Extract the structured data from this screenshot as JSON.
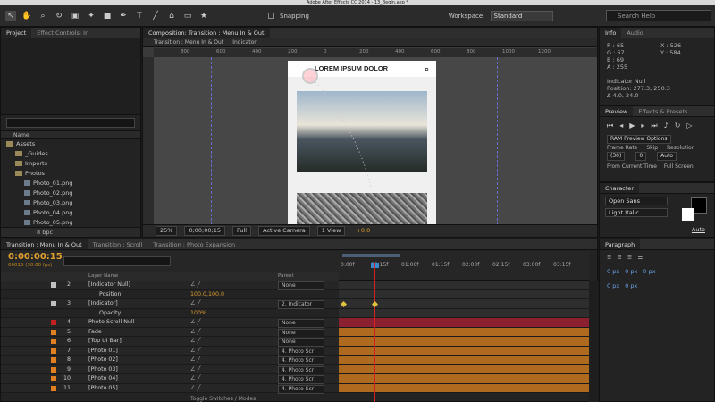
{
  "window": {
    "title": "Adobe After Effects CC 2014 - 13_Begin.aep *"
  },
  "toolbar": {
    "snapping_label": "Snapping",
    "workspace_label": "Workspace:",
    "workspace_value": "Standard",
    "search_placeholder": "Search Help"
  },
  "project": {
    "tabs": [
      "Project",
      "Effect Controls: In"
    ],
    "name_header": "Name",
    "items": [
      {
        "label": "Assets",
        "type": "folder",
        "indent": 0
      },
      {
        "label": "_Guides",
        "type": "folder",
        "indent": 1
      },
      {
        "label": "Imports",
        "type": "folder",
        "indent": 1
      },
      {
        "label": "Photos",
        "type": "folder",
        "indent": 1
      },
      {
        "label": "Photo_01.png",
        "type": "file",
        "indent": 2
      },
      {
        "label": "Photo_02.png",
        "type": "file",
        "indent": 2
      },
      {
        "label": "Photo_03.png",
        "type": "file",
        "indent": 2
      },
      {
        "label": "Photo_04.png",
        "type": "file",
        "indent": 2
      },
      {
        "label": "Photo_05.png",
        "type": "file",
        "indent": 2
      }
    ],
    "footer_bpc": "8 bpc"
  },
  "composition": {
    "tab": "Composition: Transition : Menu In & Out",
    "subtabs": [
      "Transition : Menu In & Out",
      "Indicator"
    ],
    "ruler_marks": [
      "800",
      "600",
      "400",
      "200",
      "0",
      "200",
      "400",
      "600",
      "800",
      "1000",
      "1200"
    ],
    "phone_title": "LOREM IPSUM DOLOR",
    "footer": {
      "zoom": "25%",
      "timecode": "0;00;00;15",
      "resolution": "Full",
      "camera": "Active Camera",
      "views": "1 View",
      "exposure": "+0.0"
    }
  },
  "info": {
    "tabs": [
      "Info",
      "Audio"
    ],
    "rgb": [
      "R : 65",
      "G : 67",
      "B : 69",
      "A : 255"
    ],
    "xy": [
      "X : 526",
      "Y : 584"
    ],
    "layer": "Indicator Null",
    "position": "Position: 277.3, 250.3",
    "delta": "Δ 4.0, 24.0"
  },
  "preview": {
    "tabs": [
      "Preview",
      "Effects & Presets"
    ],
    "ram_options": "RAM Preview Options",
    "labels": [
      "Frame Rate",
      "Skip",
      "Resolution"
    ],
    "values": [
      "(30)",
      "0",
      "Auto"
    ],
    "from_current": "From Current Time",
    "full_screen": "Full Screen"
  },
  "character": {
    "tab": "Character",
    "font": "Open Sans",
    "style": "Light Italic",
    "auto": "Auto"
  },
  "timeline": {
    "tabs": [
      "Transition : Menu In & Out",
      "Transition : Scroll",
      "Transition : Photo Expansion"
    ],
    "timecode": "0:00:00:15",
    "frames": "00015 (30.00 fps)",
    "col_layer_name": "Layer Name",
    "col_parent": "Parent",
    "time_marks": [
      "0:00f",
      "00:15f",
      "01:00f",
      "01:15f",
      "02:00f",
      "02:15f",
      "03:00f",
      "03:15f"
    ],
    "layers": [
      {
        "num": "2",
        "name": "[Indicator Null]",
        "parent": "None",
        "color": "#c0c0c0",
        "track": "gray"
      },
      {
        "num": "",
        "name": "Position",
        "value": "100.0,100.0",
        "track": "gray"
      },
      {
        "num": "3",
        "name": "[Indicator]",
        "parent": "2. Indicator",
        "color": "#c0c0c0",
        "track": "gray"
      },
      {
        "num": "",
        "name": "Opacity",
        "value": "100%",
        "track": "gray"
      },
      {
        "num": "4",
        "name": "Photo Scroll Null",
        "parent": "None",
        "color": "#c02020",
        "track": "red"
      },
      {
        "num": "5",
        "name": "Fade",
        "parent": "None",
        "color": "#e08020",
        "track": "orange"
      },
      {
        "num": "6",
        "name": "[Top UI Bar]",
        "parent": "None",
        "color": "#e08020",
        "track": "orange"
      },
      {
        "num": "7",
        "name": "[Photo 01]",
        "parent": "4. Photo Scr",
        "color": "#e08020",
        "track": "orange"
      },
      {
        "num": "8",
        "name": "[Photo 02]",
        "parent": "4. Photo Scr",
        "color": "#e08020",
        "track": "orange"
      },
      {
        "num": "9",
        "name": "[Photo 03]",
        "parent": "4. Photo Scr",
        "color": "#e08020",
        "track": "orange"
      },
      {
        "num": "10",
        "name": "[Photo 04]",
        "parent": "4. Photo Scr",
        "color": "#e08020",
        "track": "orange"
      },
      {
        "num": "11",
        "name": "[Photo 05]",
        "parent": "4. Photo Scr",
        "color": "#e08020",
        "track": "orange"
      }
    ],
    "toggle_label": "Toggle Switches / Modes"
  },
  "paragraph": {
    "tab": "Paragraph",
    "values": [
      "0 px",
      "0 px",
      "0 px",
      "0 px",
      "0 px"
    ]
  }
}
